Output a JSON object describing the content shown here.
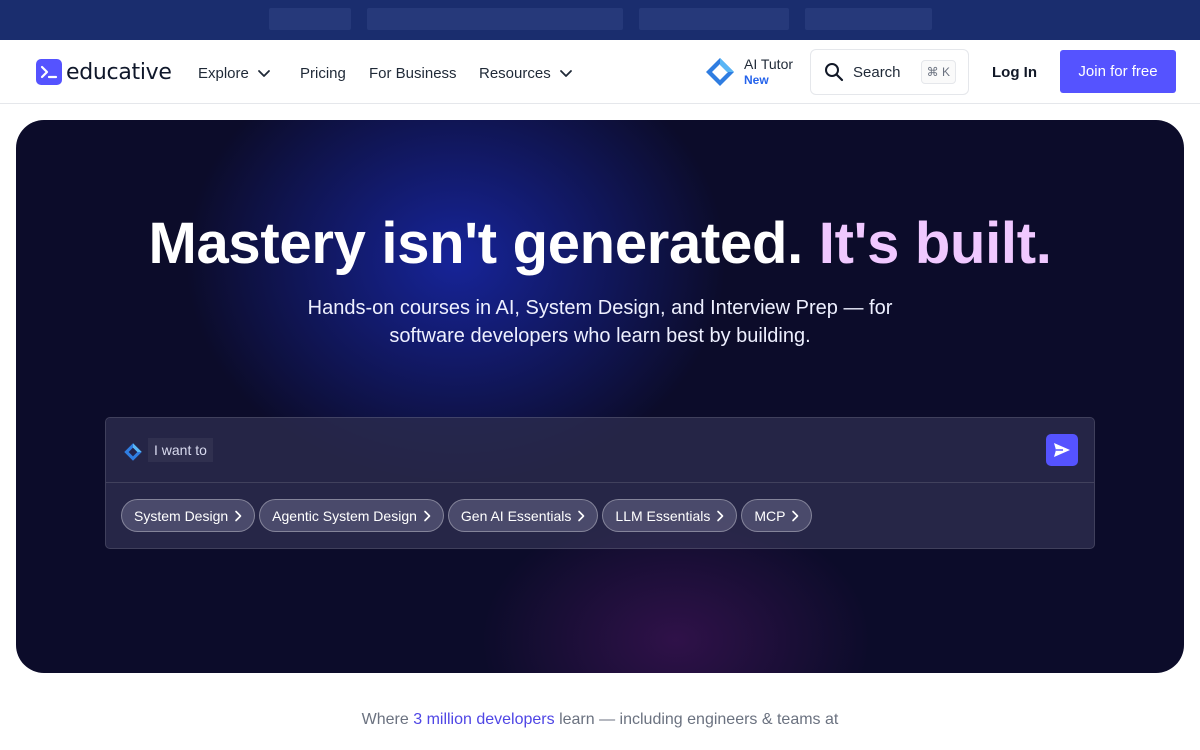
{
  "nav": {
    "logo_text": "educative",
    "items": [
      {
        "label": "Explore",
        "has_chevron": true
      },
      {
        "label": "Pricing",
        "has_chevron": false
      },
      {
        "label": "For Business",
        "has_chevron": false
      },
      {
        "label": "Resources",
        "has_chevron": true
      }
    ],
    "ai_tutor": {
      "title": "AI Tutor",
      "badge": "New",
      "icon": "ai-diamond-icon"
    },
    "search": {
      "label": "Search",
      "shortcut": "⌘ K",
      "icon": "search-icon"
    },
    "login_label": "Log In",
    "join_label": "Join for free"
  },
  "hero": {
    "title_main": "Mastery isn't generated.",
    "title_accent": "It's built.",
    "subtitle": "Hands-on courses in AI, System Design, and Interview Prep — for software developers who learn best by building.",
    "prompt": {
      "placeholder": "I want to",
      "send_icon": "send-icon",
      "chips": [
        "System Design",
        "Agentic System Design",
        "Gen AI Essentials",
        "LLM Essentials",
        "MCP"
      ]
    }
  },
  "tagline": {
    "prefix": "Where",
    "highlight": "3 million developers",
    "suffix": "learn — including engineers & teams at"
  },
  "colors": {
    "brand": "#5553ff",
    "promo_bar": "#1a2d6e",
    "hero_bg": "#0c0c2a",
    "title_accent": "#f0c8ff",
    "tagline_highlight": "#4f46e5"
  }
}
